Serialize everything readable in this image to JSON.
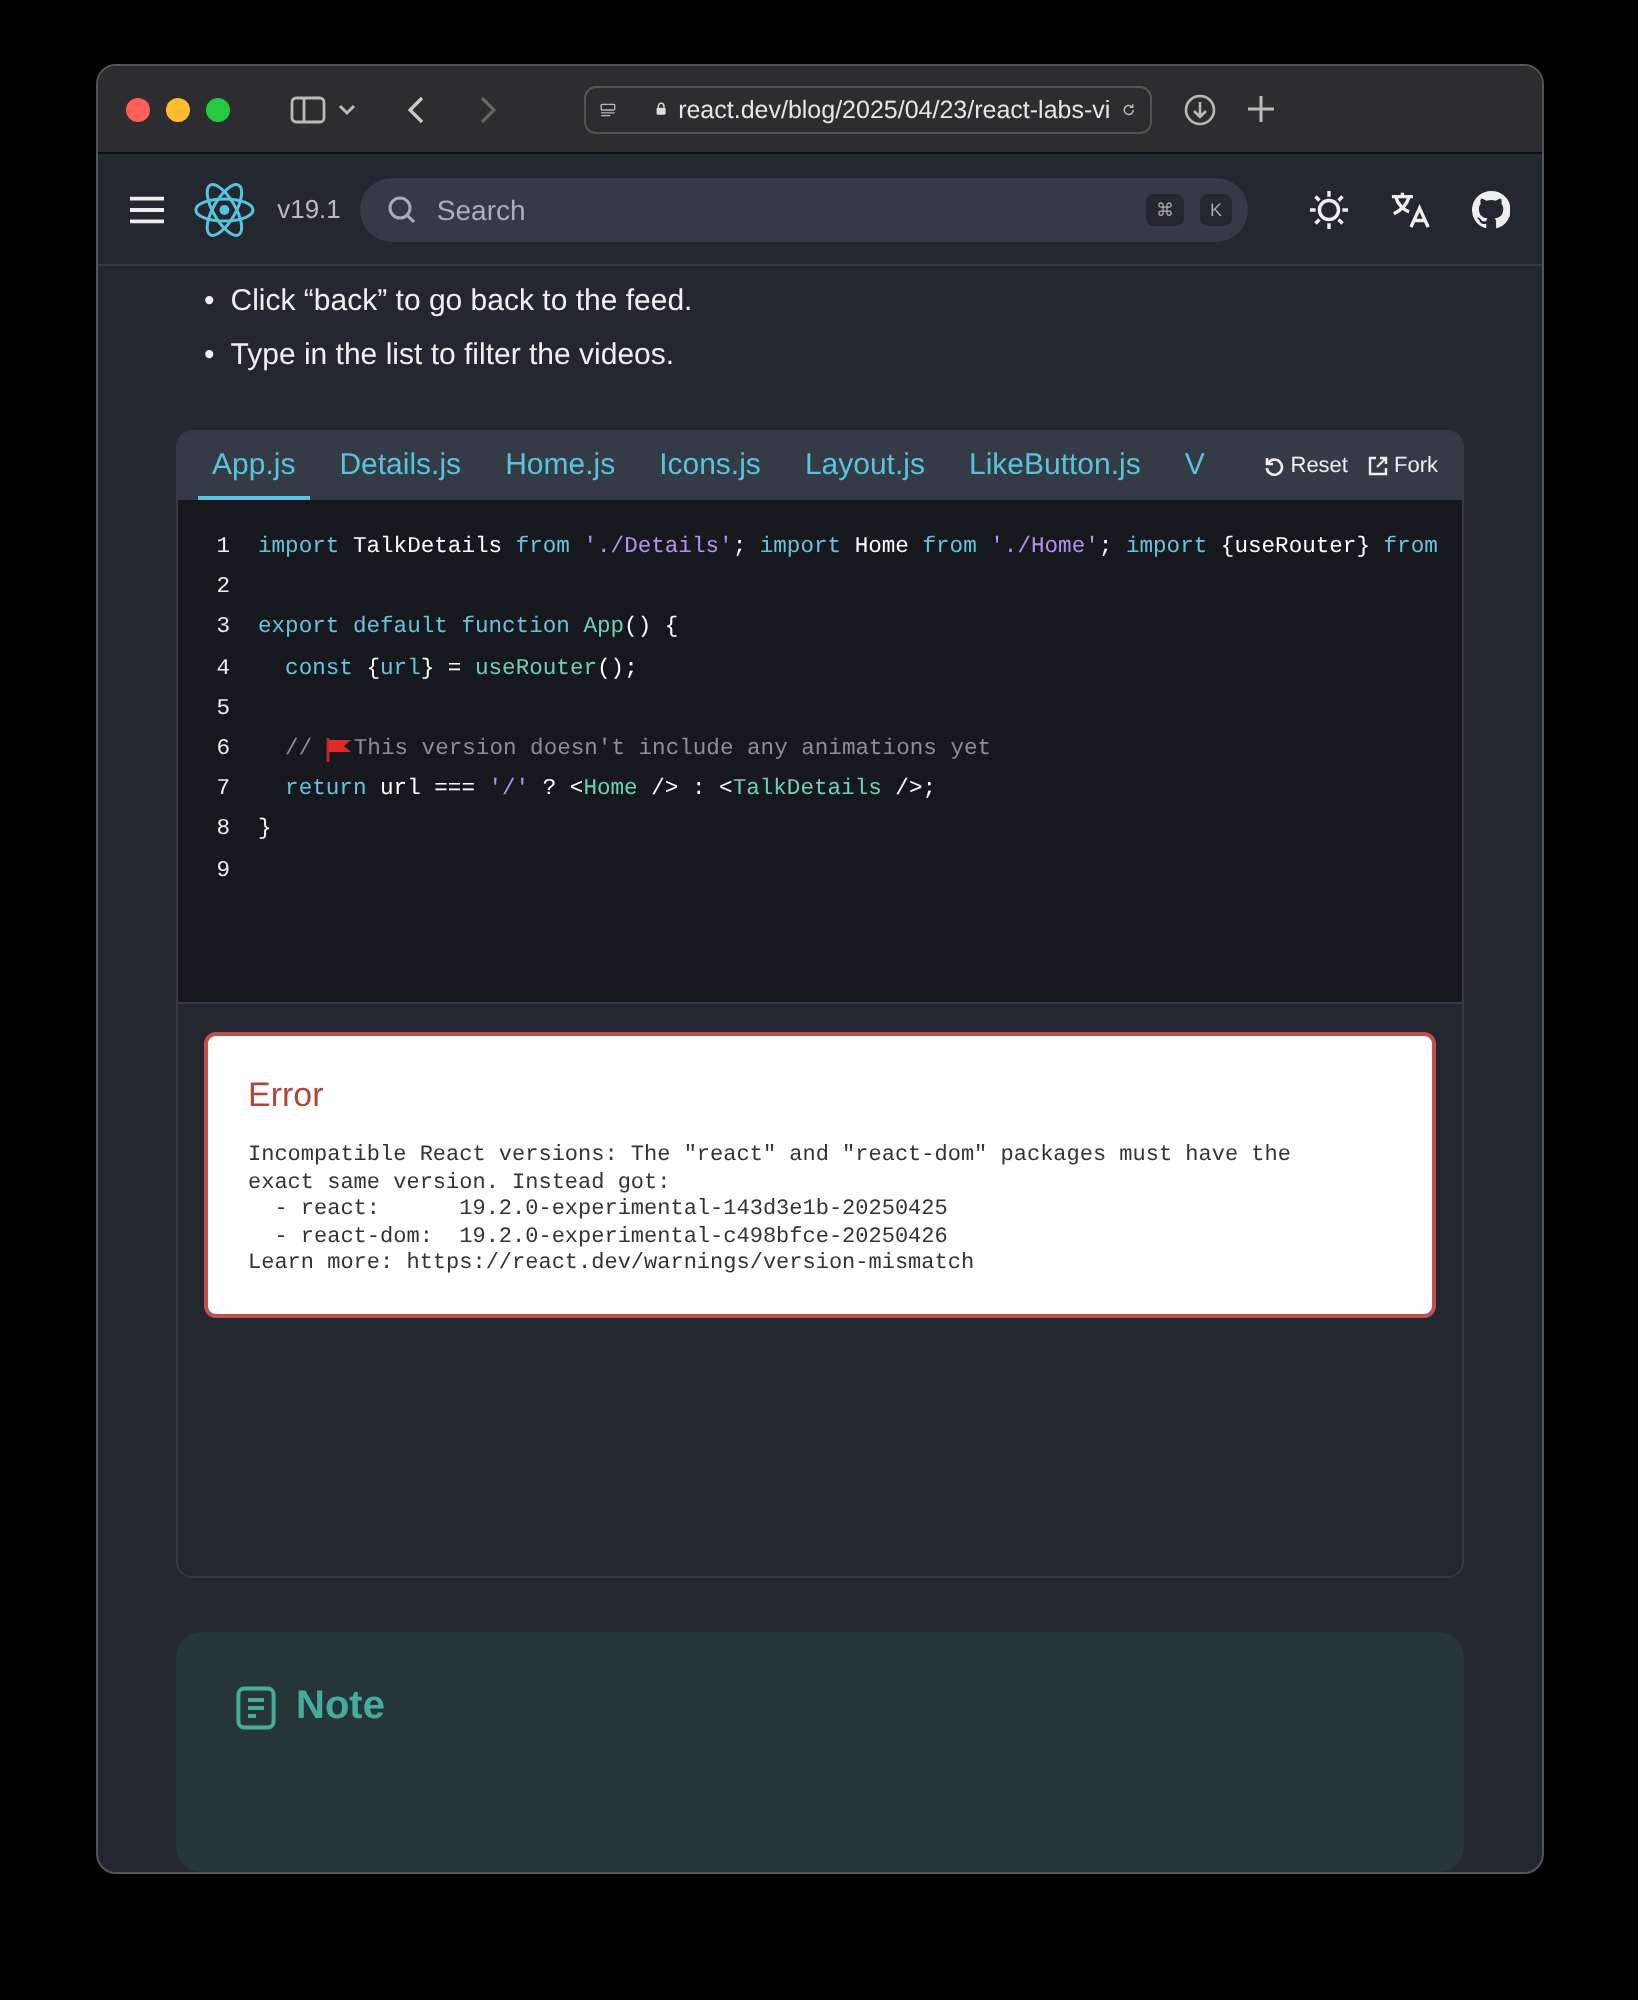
{
  "browser": {
    "url": "react.dev/blog/2025/04/23/react-labs-vi",
    "forward_disabled": true
  },
  "header": {
    "version": "v19.1",
    "search": {
      "placeholder": "Search",
      "keys": [
        "⌘",
        "K"
      ]
    }
  },
  "bullets": [
    {
      "marker": "•",
      "text": "Click “back” to go back to the feed."
    },
    {
      "marker": "•",
      "text": "Type in the list to filter the videos."
    }
  ],
  "sandbox": {
    "tabs": [
      {
        "label": "App.js",
        "selected": true
      },
      {
        "label": "Details.js",
        "selected": false
      },
      {
        "label": "Home.js",
        "selected": false
      },
      {
        "label": "Icons.js",
        "selected": false
      },
      {
        "label": "Layout.js",
        "selected": false
      },
      {
        "label": "LikeButton.js",
        "selected": false
      },
      {
        "label": "V",
        "selected": false
      }
    ],
    "actions": [
      {
        "kind": "reset",
        "label": "Reset"
      },
      {
        "kind": "fork",
        "label": "Fork"
      }
    ],
    "code": [
      {
        "number": "1",
        "tokens": [
          {
            "kind": "keyword",
            "text": "import"
          },
          {
            "kind": "plain",
            "text": " TalkDetails "
          },
          {
            "kind": "keyword",
            "text": "from"
          },
          {
            "kind": "string",
            "text": " './Details'"
          },
          {
            "kind": "plain",
            "text": "; "
          },
          {
            "kind": "keyword",
            "text": "import"
          },
          {
            "kind": "plain",
            "text": " Home "
          },
          {
            "kind": "keyword",
            "text": "from"
          },
          {
            "kind": "string",
            "text": " './Home'"
          },
          {
            "kind": "plain",
            "text": "; "
          },
          {
            "kind": "keyword",
            "text": "import"
          },
          {
            "kind": "plain",
            "text": " {useRouter} "
          },
          {
            "kind": "keyword",
            "text": "from"
          }
        ]
      },
      {
        "number": "2"
      },
      {
        "number": "3",
        "tokens": [
          {
            "kind": "keyword",
            "text": "export default function "
          },
          {
            "kind": "fn",
            "text": "App"
          },
          {
            "kind": "plain",
            "text": "() {"
          }
        ]
      },
      {
        "number": "4",
        "tokens": [
          {
            "kind": "keyword",
            "text": "  const"
          },
          {
            "kind": "plain",
            "text": " {"
          },
          {
            "kind": "keyword",
            "text": "url"
          },
          {
            "kind": "plain",
            "text": "} = "
          },
          {
            "kind": "fn",
            "text": "useRouter"
          },
          {
            "kind": "plain",
            "text": "();"
          }
        ]
      },
      {
        "number": "5"
      },
      {
        "number": "6",
        "tokens": [
          {
            "kind": "comment",
            "text": "  // "
          },
          {
            "kind": "flag"
          },
          {
            "kind": "comment",
            "text": "This version doesn't include any animations yet"
          }
        ]
      },
      {
        "number": "7",
        "tokens": [
          {
            "kind": "keyword",
            "text": "  return"
          },
          {
            "kind": "plain",
            "text": " url === "
          },
          {
            "kind": "string",
            "text": "'/'"
          },
          {
            "kind": "plain",
            "text": " ? <"
          },
          {
            "kind": "fn",
            "text": "Home"
          },
          {
            "kind": "plain",
            "text": " /> : <"
          },
          {
            "kind": "fn",
            "text": "TalkDetails"
          },
          {
            "kind": "plain",
            "text": " />;"
          }
        ]
      },
      {
        "number": "8",
        "tokens": [
          {
            "kind": "plain",
            "text": "}"
          }
        ]
      },
      {
        "number": "9"
      }
    ],
    "error": {
      "title": "Error",
      "message": "Incompatible React versions: The \"react\" and \"react-dom\" packages must have the\nexact same version. Instead got:\n  - react:      19.2.0-experimental-143d3e1b-20250425\n  - react-dom:  19.2.0-experimental-c498bfce-20250426\nLearn more: https://react.dev/warnings/version-mismatch"
    }
  },
  "note": {
    "title": "Note"
  }
}
